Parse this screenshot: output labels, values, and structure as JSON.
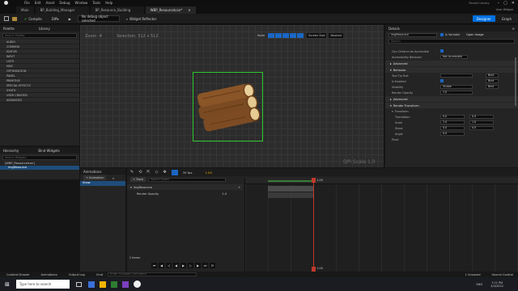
{
  "menu": [
    "File",
    "Edit",
    "Asset",
    "Debug",
    "Window",
    "Tools",
    "Help"
  ],
  "project_label": "Paraist Library",
  "user_widget": "User Widget",
  "tabs": [
    "Main",
    "BP_Building_Manager",
    "BP_Resource_Building",
    "WBP_Resourcelcon*"
  ],
  "toolbar": {
    "compile": "Compile",
    "diff": "Diff",
    "debug": "No debug object selected",
    "reflector": "Widget Reflector",
    "designer": "Designer",
    "graph": "Graph"
  },
  "palette": {
    "title": "Palette",
    "library": "Library",
    "search": "Search Palette",
    "categories": [
      "AUDIO",
      "COMMON",
      "EDITOR",
      "INPUT",
      "LISTS",
      "MISC",
      "OPTIMIZATION",
      "PANEL",
      "PRIMITIVE",
      "SPECIAL EFFECTS",
      "SYNTH",
      "USER CREATED",
      "ADVANCED"
    ]
  },
  "hierarchy": {
    "title": "Hierarchy",
    "bind": "Bind Widgets",
    "search": "Search Widgets",
    "root": "[WBP_Resourcelcon]",
    "child": "imgResource"
  },
  "canvas": {
    "zoom": "Zoom -4",
    "selection": "Selection: 512 x 512",
    "none_label": "None",
    "screen_size": "Screen Size",
    "desired": "Desired",
    "dpi": "DPI Scale 1.0"
  },
  "details": {
    "title": "Details",
    "name": "imgResource",
    "is_variable": "Is Variable",
    "open_image": "Open Image",
    "search": "Search",
    "rows_top": [
      {
        "label": "Can Children be Accessible",
        "value": ""
      },
      {
        "label": "Accessibility Behavior",
        "value": "Not Accessible"
      }
    ],
    "advanced1": "Advanced",
    "behavior": "Behavior",
    "behavior_rows": [
      {
        "label": "Tool Tip Text",
        "value": "",
        "bind": "Bind"
      },
      {
        "label": "Is Enabled",
        "value": "",
        "bind": "Bind"
      },
      {
        "label": "Visibility",
        "value": "Visible",
        "bind": "Bind"
      },
      {
        "label": "Render Opacity",
        "value": "1.0",
        "bind": ""
      }
    ],
    "advanced2": "Advanced",
    "render_transform": "Render Transform",
    "transform": "Transform",
    "transform_rows": [
      {
        "label": "Translation",
        "x": "0.0",
        "y": "0.0"
      },
      {
        "label": "Scale",
        "x": "1.0",
        "y": "1.0"
      },
      {
        "label": "Shear",
        "x": "0.0",
        "y": "0.0"
      },
      {
        "label": "Angle",
        "x": "0.0",
        "y": ""
      }
    ],
    "pivot": "Pivot"
  },
  "animations": {
    "title": "Animations",
    "add": "+ Animation",
    "item": "Show"
  },
  "timeline": {
    "track": "+ Track",
    "search": "Search Tracks",
    "fps": "30 fps",
    "time": "1.00",
    "row1": "imgResource",
    "row2": "Render Opacity",
    "row2_val": "1.0",
    "items": "2 items",
    "playhead": "1.00",
    "end": "1.00"
  },
  "bottom": {
    "content_drawer": "Content Drawer",
    "animations": "Animations",
    "output": "Output Log",
    "cmd": "Cmd",
    "console": "Enter Console Command",
    "unsaved": "1 Unsaved",
    "source": "Source Control"
  },
  "taskbar": {
    "search": "Type here to search",
    "lang": "ENG",
    "time": "7:11 PM",
    "date": "4/4/2022"
  }
}
